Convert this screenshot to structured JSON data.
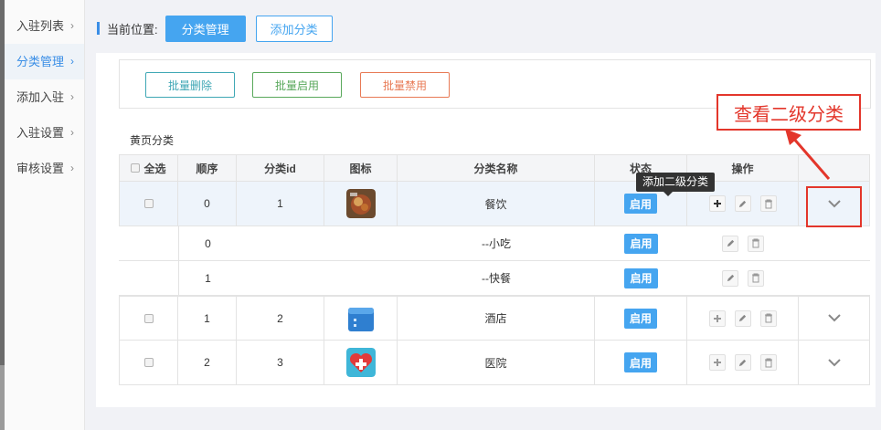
{
  "sidebar": {
    "items": [
      {
        "label": "入驻列表",
        "active": false
      },
      {
        "label": "分类管理",
        "active": true
      },
      {
        "label": "添加入驻",
        "active": false
      },
      {
        "label": "入驻设置",
        "active": false
      },
      {
        "label": "审核设置",
        "active": false
      }
    ],
    "arrow_glyph": "›"
  },
  "breadcrumb": {
    "label": "当前位置:",
    "current_button": "分类管理",
    "add_button": "添加分类"
  },
  "toolbar": {
    "batch_delete": "批量删除",
    "batch_enable": "批量启用",
    "batch_disable": "批量禁用"
  },
  "section_title": "黄页分类",
  "table": {
    "headers": {
      "select_all": "全选",
      "order": "顺序",
      "id": "分类id",
      "icon": "图标",
      "name": "分类名称",
      "status": "状态",
      "actions": "操作"
    },
    "rows": [
      {
        "order": "0",
        "id": "1",
        "icon": "food-photo-icon",
        "name": "餐饮",
        "status": "启用"
      },
      {
        "order": "0",
        "name": "--小吃",
        "status": "启用"
      },
      {
        "order": "1",
        "name": "--快餐",
        "status": "启用"
      },
      {
        "order": "1",
        "id": "2",
        "icon": "hotel-building-icon",
        "name": "酒店",
        "status": "启用"
      },
      {
        "order": "2",
        "id": "3",
        "icon": "medical-heart-icon",
        "name": "医院",
        "status": "启用"
      }
    ]
  },
  "tooltip": "添加二级分类",
  "callout": "查看二级分类",
  "colors": {
    "primary": "#45a5f0",
    "delete": "#3fa7b5",
    "enable": "#59a85b",
    "disable": "#e87a55",
    "annotation_red": "#e3362b"
  }
}
